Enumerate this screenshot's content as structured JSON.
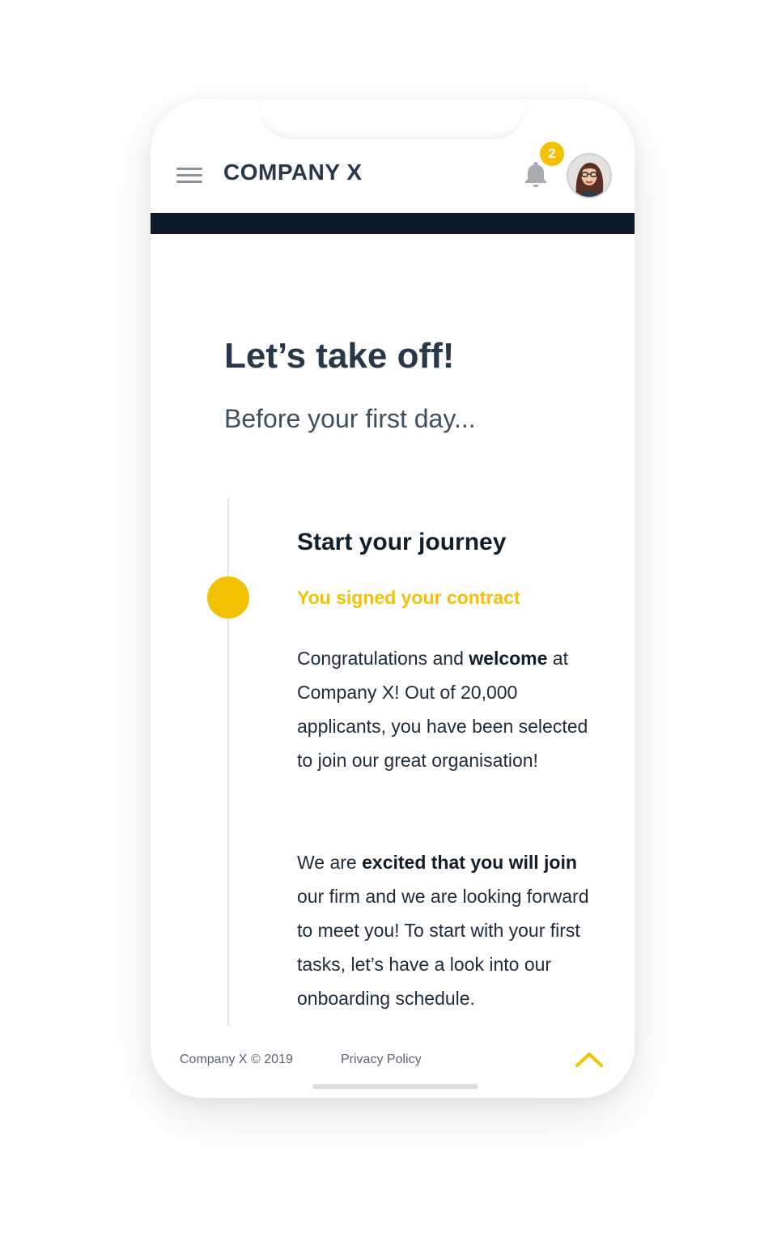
{
  "header": {
    "brand": "COMPANY X",
    "notification_count": "2",
    "menu_icon": "hamburger-icon",
    "bell_icon": "bell-icon",
    "avatar_icon": "user-avatar"
  },
  "main": {
    "title": "Let’s take off!",
    "subtitle": "Before your first day...",
    "step": {
      "title": "Start your journey",
      "status": "You signed your contract",
      "para1": {
        "t1": "Congratulations and ",
        "b1": "welcome",
        "t2": " at Company X! Out of 20,000 applicants, you have been selected to join our great organisation!"
      },
      "para2": {
        "t1": "We are ",
        "b1": "excited that you will join",
        "t2": " our firm and we are looking forward to meet you! To start with your first tasks, let’s have a look into our onboarding schedule."
      }
    }
  },
  "footer": {
    "copyright": "Company X © 2019",
    "privacy": "Privacy Policy",
    "up_icon": "chevron-up-icon"
  },
  "colors": {
    "accent": "#f2c200",
    "navbar": "#0d1b2a",
    "text": "#26384a"
  }
}
